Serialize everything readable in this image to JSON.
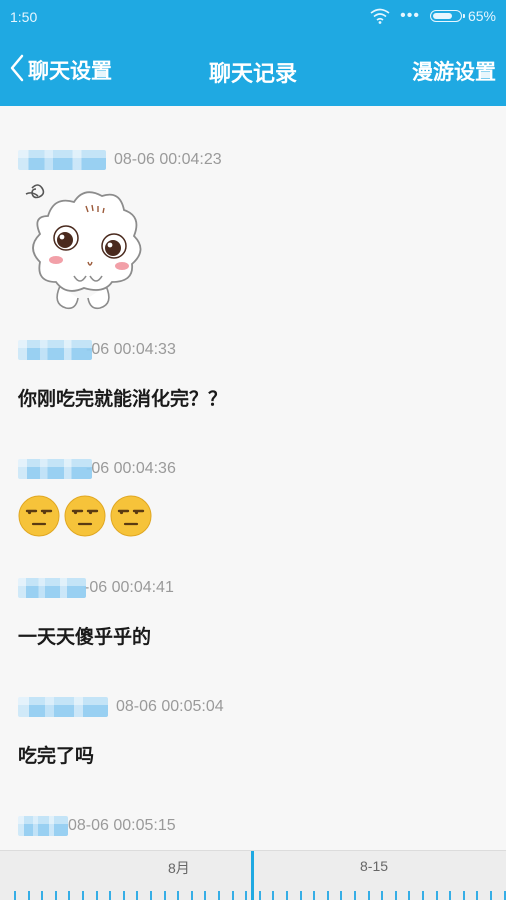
{
  "status_bar": {
    "time": "1:50",
    "signal": "•••",
    "battery_percent": "65%",
    "battery_level": 0.65
  },
  "header": {
    "back_label": "聊天设置",
    "title": "聊天记录",
    "right_button": "漫游设置"
  },
  "messages": [
    {
      "time": "08-06  00:04:23",
      "type": "sticker",
      "sticker": "cloud-sticker-icon"
    },
    {
      "time": "-06  00:04:33",
      "type": "text",
      "text": " 你刚吃完就能消化完？？"
    },
    {
      "time": "-06  00:04:36",
      "type": "emoji",
      "emoji": [
        "unamused-emoji-icon",
        "unamused-emoji-icon",
        "unamused-emoji-icon"
      ]
    },
    {
      "time": "-06  00:04:41",
      "type": "text",
      "text": "一天天傻乎乎的"
    },
    {
      "time": "08-06  00:05:04",
      "type": "text",
      "text": "吃完了吗"
    },
    {
      "time": "08-06  00:05:15",
      "type": "text",
      "text": ""
    }
  ],
  "timeline": {
    "labels": [
      "8月",
      "8-15"
    ]
  },
  "colors": {
    "accent": "#1fa9e2",
    "background": "#f7f7f7",
    "timestamp": "#9a9a9a"
  }
}
